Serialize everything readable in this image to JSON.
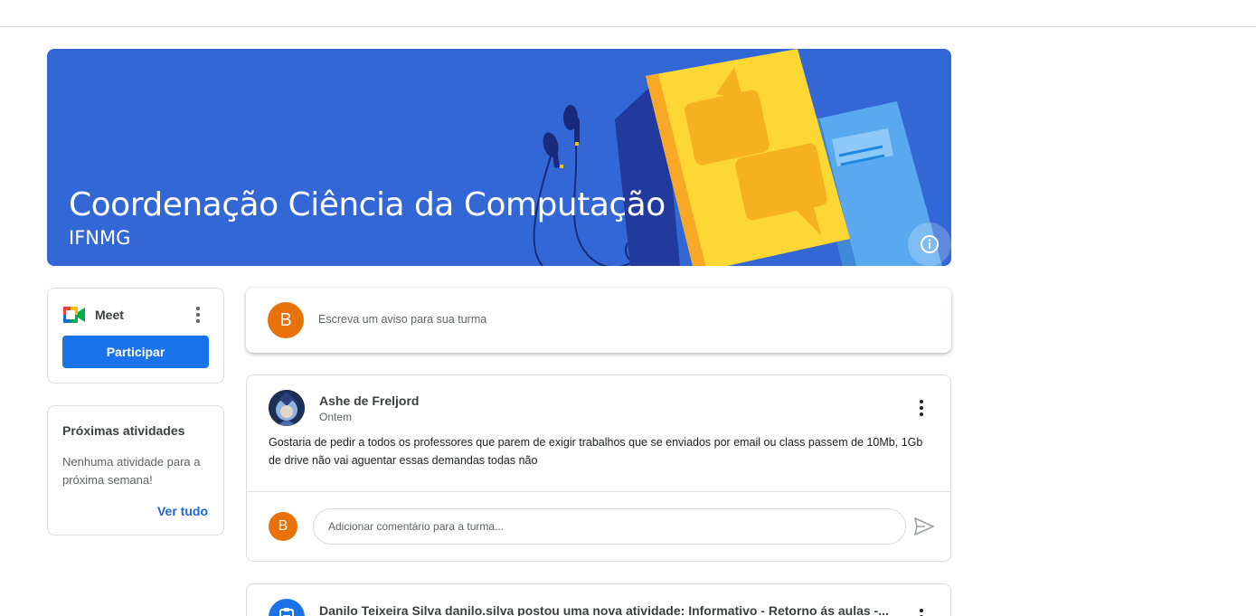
{
  "banner": {
    "title": "Coordenação Ciência da Computação",
    "subtitle": "IFNMG",
    "info_icon": "info-icon",
    "color": "#3367d6"
  },
  "meet": {
    "label": "Meet",
    "join_label": "Participar",
    "logo_icon": "google-meet-icon",
    "menu_icon": "more-vert-icon"
  },
  "upcoming": {
    "title": "Próximas atividades",
    "text": "Nenhuma atividade para a próxima semana!",
    "link": "Ver tudo"
  },
  "composer": {
    "avatar_letter": "B",
    "placeholder": "Escreva um aviso para sua turma"
  },
  "post": {
    "author": "Ashe de Freljord",
    "time": "Ontem",
    "body": "Gostaria de pedir a todos os professores que parem de exigir trabalhos que se enviados por email ou class passem de 10Mb, 1Gb de drive não vai aguentar essas demandas todas não",
    "comment_avatar_letter": "B",
    "comment_placeholder": "Adicionar comentário para a turma...",
    "send_icon": "send-icon"
  },
  "post2": {
    "title": "Danilo Teixeira Silva danilo.silva postou uma nova atividade: Informativo - Retorno ás aulas -...",
    "icon": "assignment-icon"
  },
  "colors": {
    "accent": "#1a73e8",
    "avatar": "#e8710a",
    "link": "#1967d2"
  }
}
